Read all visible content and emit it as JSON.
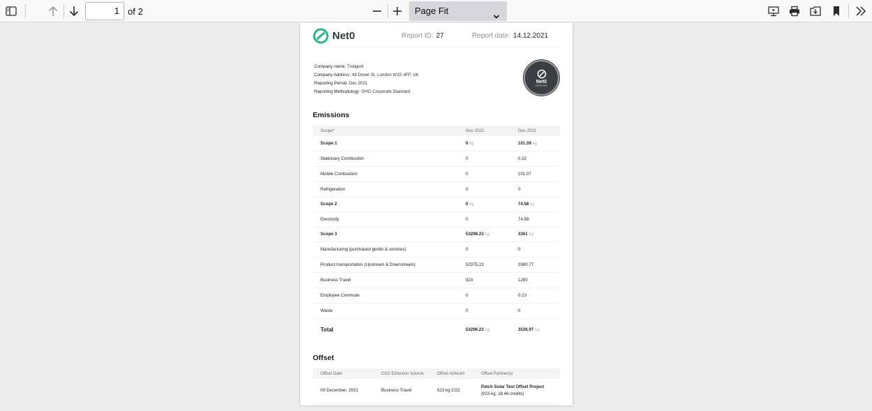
{
  "toolbar": {
    "page_number": "1",
    "page_of": "of 2",
    "zoom": "Page Fit"
  },
  "report": {
    "logo": "Net0",
    "report_id_label": "Report ID:",
    "report_id": "27",
    "report_date_label": "Report date:",
    "report_date": "14.12.2021",
    "company_name_label": "Company name:",
    "company_name": "Truligent",
    "company_address_label": "Company Address:",
    "company_address": "48 Dover St, London W1S 4FF, UK",
    "reporting_period_label": "Reporting Period:",
    "reporting_period": "Dec 2021",
    "methodology_label": "Reporting Methodology:",
    "methodology": "GHG Corporate Standard",
    "badge_title": "Net0",
    "badge_sub": "VERIFIED"
  },
  "emissions": {
    "title": "Emissions",
    "headers": [
      "Scope*",
      "Nov 2021",
      "Dec 2021"
    ],
    "unit": "kg",
    "rows": [
      {
        "label": "Scope 1",
        "nov": "0",
        "dec": "101.39"
      },
      {
        "label": "Stationary Combustion",
        "nov": "0",
        "dec": "0.32"
      },
      {
        "label": "Mobile Combustion",
        "nov": "0",
        "dec": "101.07"
      },
      {
        "label": "Refrigeration",
        "nov": "0",
        "dec": "0"
      },
      {
        "label": "Scope 2",
        "nov": "0",
        "dec": "74.58"
      },
      {
        "label": "Electricity",
        "nov": "0",
        "dec": "74.58"
      },
      {
        "label": "Scope 3",
        "nov": "53298.23",
        "dec": "3361"
      },
      {
        "label": "Manufacturing (purchased goods & services)",
        "nov": "0",
        "dec": "0"
      },
      {
        "label": "Product transportation (Upstream & Downstream)",
        "nov": "52375.23",
        "dec": "2080.77"
      },
      {
        "label": "Business Travel",
        "nov": "923",
        "dec": "1280"
      },
      {
        "label": "Employee Commute",
        "nov": "0",
        "dec": "0.23"
      },
      {
        "label": "Waste",
        "nov": "0",
        "dec": "0"
      },
      {
        "label": "Total",
        "nov": "53298.23",
        "dec": "3536.97"
      }
    ]
  },
  "offset": {
    "title": "Offset",
    "headers": [
      "Offset Date",
      "CO2 Emission Source",
      "Offset Amount",
      "Offset Partner(s)"
    ],
    "rows": [
      {
        "date": "09 December, 2021",
        "source": "Business Travel",
        "amount": "923 kg CO2",
        "partner": "Patch Solar Test Offset Project",
        "partner_detail": "(923 kg, 18.46 credits)"
      }
    ]
  }
}
